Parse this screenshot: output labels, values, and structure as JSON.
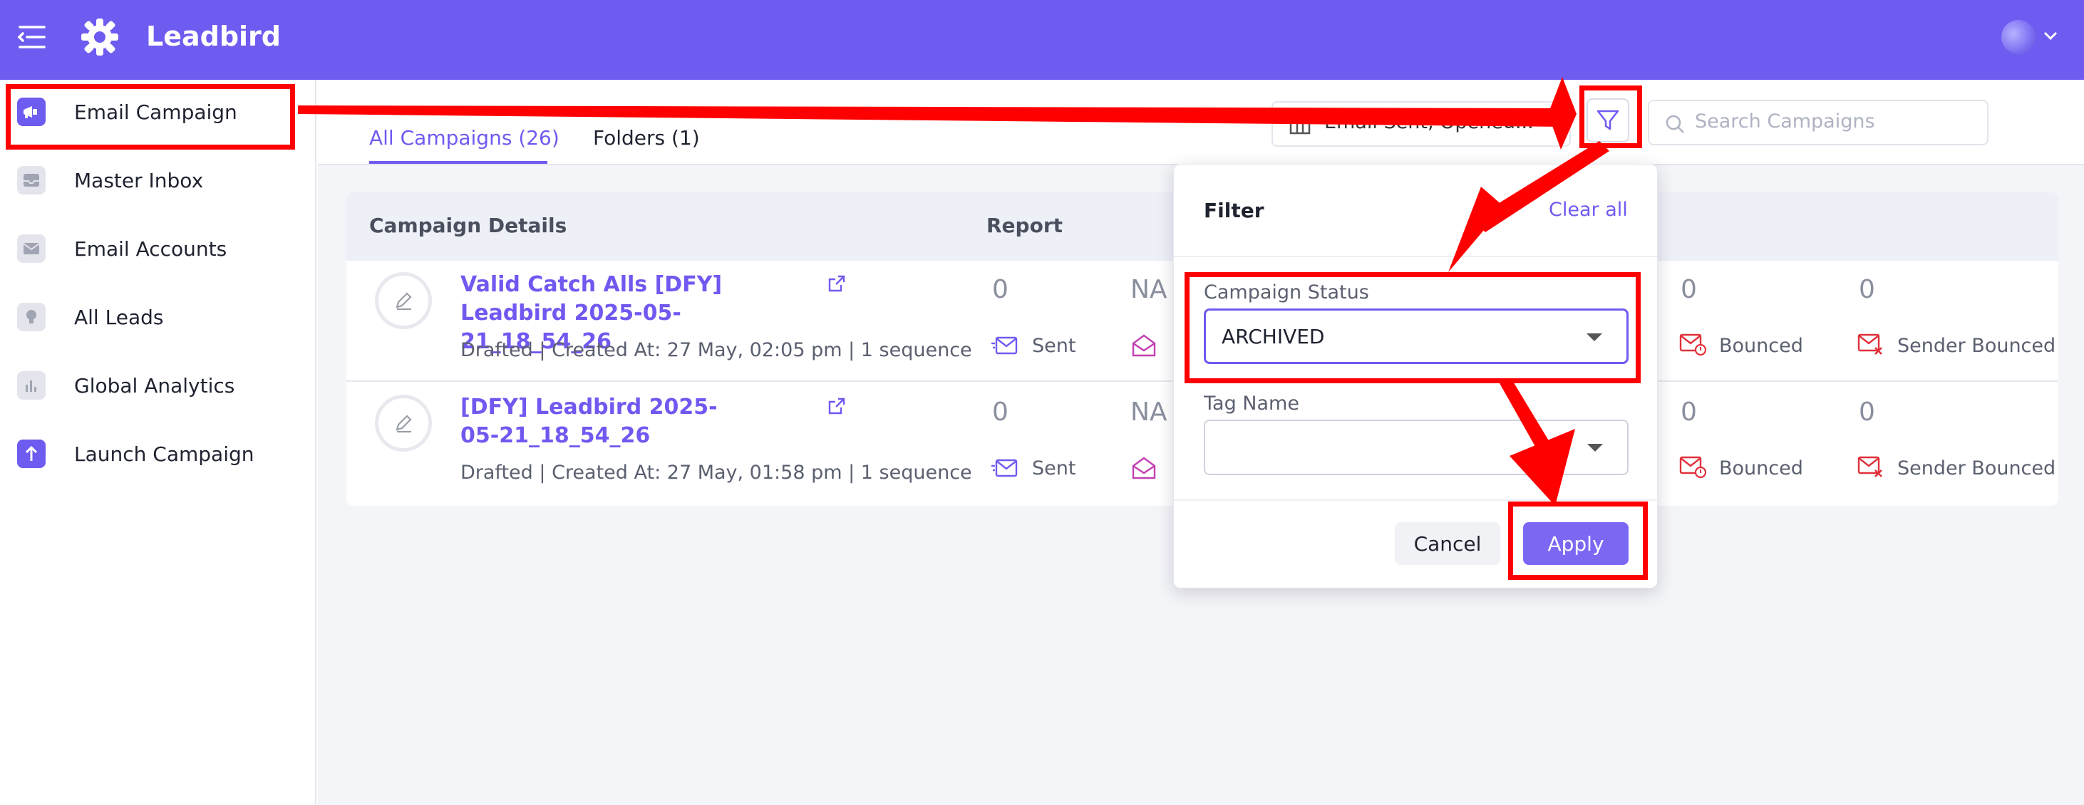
{
  "app": {
    "brand": "Leadbird"
  },
  "sidebar": {
    "items": [
      {
        "label": "Email Campaign",
        "icon": "megaphone-icon"
      },
      {
        "label": "Master Inbox",
        "icon": "inbox-icon"
      },
      {
        "label": "Email Accounts",
        "icon": "envelope-icon"
      },
      {
        "label": "All Leads",
        "icon": "bulb-icon"
      },
      {
        "label": "Global Analytics",
        "icon": "bar-chart-icon"
      },
      {
        "label": "Launch Campaign",
        "icon": "arrow-up-icon"
      }
    ]
  },
  "tabs": [
    {
      "label": "All Campaigns (26)",
      "active": true
    },
    {
      "label": "Folders (1)",
      "active": false
    }
  ],
  "toolbar": {
    "columns_label": "Email Sent, Opened...",
    "search_placeholder": "Search Campaigns"
  },
  "table": {
    "headers": [
      "Campaign Details",
      "Report"
    ],
    "rows": [
      {
        "name": "Valid Catch Alls [DFY] Leadbird 2025-05-21_18_54_26",
        "meta": "Drafted | Created At: 27 May, 02:05 pm | 1 sequence",
        "sent_value": "0",
        "sent_label": "Sent",
        "opened_value": "NA",
        "bounced_value": "0",
        "bounced_label": "Bounced",
        "sender_bounced_value": "0",
        "sender_bounced_label": "Sender Bounced"
      },
      {
        "name": "[DFY] Leadbird 2025-05-21_18_54_26",
        "meta": "Drafted | Created At: 27 May, 01:58 pm | 1 sequence",
        "sent_value": "0",
        "sent_label": "Sent",
        "opened_value": "NA",
        "bounced_value": "0",
        "bounced_label": "Bounced",
        "sender_bounced_value": "0",
        "sender_bounced_label": "Sender Bounced"
      }
    ]
  },
  "filter": {
    "title": "Filter",
    "clear_label": "Clear all",
    "status_label": "Campaign Status",
    "status_value": "ARCHIVED",
    "tag_label": "Tag Name",
    "tag_value": "",
    "cancel_label": "Cancel",
    "apply_label": "Apply"
  },
  "colors": {
    "brand": "#6e5bf0",
    "annotation": "#ff0000"
  }
}
